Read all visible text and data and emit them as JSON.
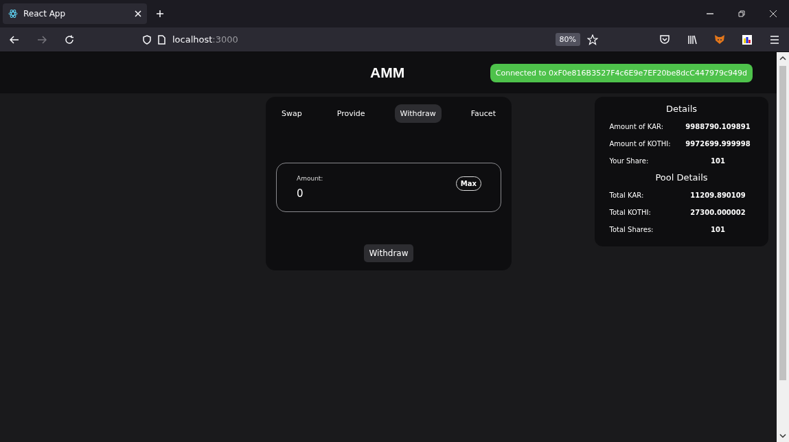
{
  "browser": {
    "tab_title": "React App",
    "url_host": "localhost",
    "url_port": ":3000",
    "zoom": "80%"
  },
  "header": {
    "title": "AMM",
    "status": "Connected to 0xF0e816B3527F4c6E9e7EF20be8dcC447979c949d"
  },
  "tabs": [
    {
      "label": "Swap",
      "selected": false
    },
    {
      "label": "Provide",
      "selected": false
    },
    {
      "label": "Withdraw",
      "selected": true
    },
    {
      "label": "Faucet",
      "selected": false
    }
  ],
  "form": {
    "label": "Amount:",
    "value": "0",
    "max_button": "Max",
    "submit": "Withdraw"
  },
  "details": {
    "title": "Details",
    "rows": [
      {
        "label": "Amount of KAR:",
        "value": "9988790.109891"
      },
      {
        "label": "Amount of KOTHI:",
        "value": "9972699.999998"
      },
      {
        "label": "Your Share:",
        "value": "101"
      }
    ]
  },
  "pool_details": {
    "title": "Pool Details",
    "rows": [
      {
        "label": "Total KAR:",
        "value": "11209.890109"
      },
      {
        "label": "Total KOTHI:",
        "value": "27300.000002"
      },
      {
        "label": "Total Shares:",
        "value": "101"
      }
    ]
  }
}
